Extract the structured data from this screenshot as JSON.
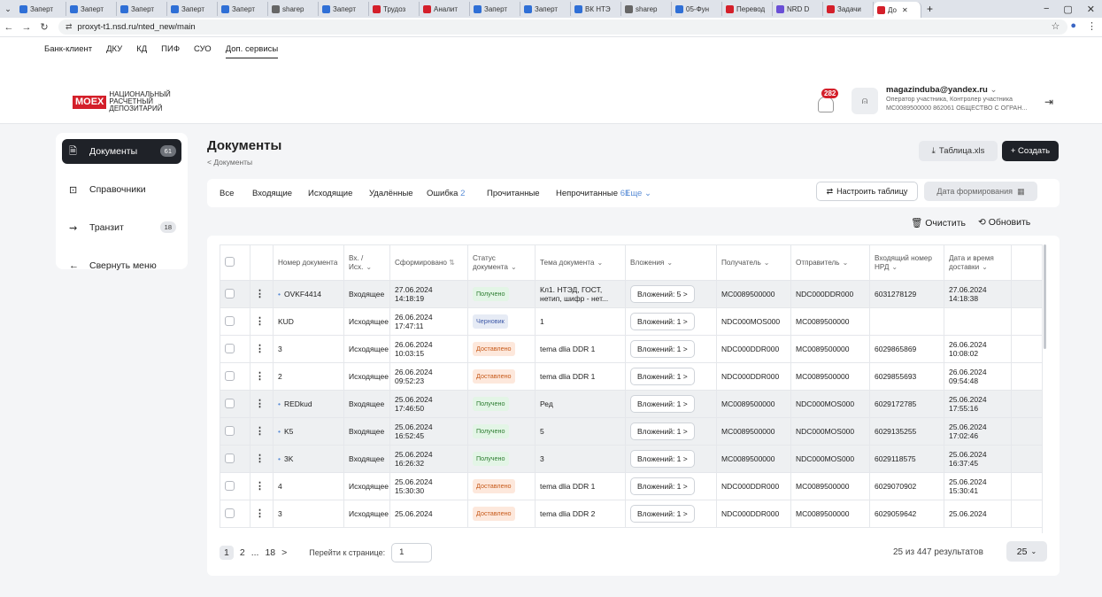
{
  "browser": {
    "tabs": [
      {
        "label": "Заперт",
        "color": "#2f6fd6"
      },
      {
        "label": "Заперт",
        "color": "#2f6fd6"
      },
      {
        "label": "Заперт",
        "color": "#2f6fd6"
      },
      {
        "label": "Заперт",
        "color": "#2f6fd6"
      },
      {
        "label": "Заперт",
        "color": "#2f6fd6"
      },
      {
        "label": "sharep",
        "color": "#666666"
      },
      {
        "label": "Заперт",
        "color": "#2f6fd6"
      },
      {
        "label": "Трудоз",
        "color": "#d41f2a"
      },
      {
        "label": "Аналит",
        "color": "#d41f2a"
      },
      {
        "label": "Заперт",
        "color": "#2f6fd6"
      },
      {
        "label": "Заперт",
        "color": "#2f6fd6"
      },
      {
        "label": "ВК НТЭ",
        "color": "#2f6fd6"
      },
      {
        "label": "sharep",
        "color": "#666666"
      },
      {
        "label": "05-Фун",
        "color": "#2f6fd6"
      },
      {
        "label": "Перевод",
        "color": "#d41f2a"
      },
      {
        "label": "NRD D",
        "color": "#6a4fd6"
      },
      {
        "label": "Задачи",
        "color": "#d41f2a"
      },
      {
        "label": "До",
        "color": "#d41f2a",
        "active": true
      }
    ],
    "new_tab": "+",
    "url": "proxyt-t1.nsd.ru/nted_new/main",
    "win_min": "−",
    "win_max": "▢",
    "win_close": "✕"
  },
  "site_menu": [
    "Банк-клиент",
    "ДКУ",
    "КД",
    "ПИФ",
    "СУО",
    "Доп. сервисы"
  ],
  "logo": {
    "moex": "MOEX",
    "line1": "НАЦИОНАЛЬНЫЙ",
    "line2": "РАСЧЕТНЫЙ",
    "line3": "ДЕПОЗИТАРИЙ"
  },
  "header": {
    "notifications": "282",
    "email": "magazinduba@yandex.ru",
    "role": "Оператор участника, Контролер участника",
    "org": "MC0089500000 862061 ОБЩЕСТВО С ОГРАН..."
  },
  "sidebar": {
    "items": [
      {
        "label": "Документы",
        "count": "61",
        "icon": "document-icon"
      },
      {
        "label": "Справочники",
        "count": "",
        "icon": "directory-icon"
      },
      {
        "label": "Транзит",
        "count": "18",
        "icon": "transit-icon"
      },
      {
        "label": "Свернуть меню",
        "count": "",
        "icon": "arrow-left-icon"
      }
    ]
  },
  "page": {
    "title": "Документы",
    "breadcrumb": "< Документы",
    "xls_button": "Таблица.xls",
    "create_button": "+ Создать"
  },
  "filters": {
    "tabs": [
      {
        "label": "Все",
        "count": ""
      },
      {
        "label": "Входящие",
        "count": ""
      },
      {
        "label": "Исходящие",
        "count": ""
      },
      {
        "label": "Удалённые",
        "count": ""
      },
      {
        "label": "Ошибка",
        "count": "2"
      },
      {
        "label": "Прочитанные",
        "count": ""
      },
      {
        "label": "Непрочитанные",
        "count": "61"
      }
    ],
    "more": "Еще",
    "configure": "Настроить таблицу",
    "date": "Дата формирования"
  },
  "actions": {
    "clear": "Очистить",
    "refresh": "Обновить"
  },
  "table": {
    "headers": [
      "Номер документа",
      "Вх. / Исх.",
      "Сформировано",
      "Статус документа",
      "Тема документа",
      "Вложения",
      "Получатель",
      "Отправитель",
      "Входящий номер НРД",
      "Дата и время доставки"
    ],
    "rows": [
      {
        "num": "OVKF4414",
        "unread": true,
        "dir": "Входящее",
        "date": "27.06.2024",
        "time": "14:18:19",
        "status": "Получено",
        "topic": "Кл1. НТЭД, ГОСТ, нетип, шифр - нет...",
        "att": "Вложений: 5 >",
        "rcpt": "MC0089500000",
        "sender": "NDC000DDR000",
        "nrd": "6031278129",
        "ddate": "27.06.2024",
        "dtime": "14:18:38"
      },
      {
        "num": "KUD",
        "unread": false,
        "dir": "Исходящее",
        "date": "26.06.2024",
        "time": "17:47:11",
        "status": "Черновик",
        "topic": "1",
        "att": "Вложений: 1 >",
        "rcpt": "NDC000MOS000",
        "sender": "MC0089500000",
        "nrd": "",
        "ddate": "",
        "dtime": ""
      },
      {
        "num": "3",
        "unread": false,
        "dir": "Исходящее",
        "date": "26.06.2024",
        "time": "10:03:15",
        "status": "Доставлено",
        "topic": "tema dlia DDR 1",
        "att": "Вложений: 1 >",
        "rcpt": "NDC000DDR000",
        "sender": "MC0089500000",
        "nrd": "6029865869",
        "ddate": "26.06.2024",
        "dtime": "10:08:02"
      },
      {
        "num": "2",
        "unread": false,
        "dir": "Исходящее",
        "date": "26.06.2024",
        "time": "09:52:23",
        "status": "Доставлено",
        "topic": "tema dlia DDR 1",
        "att": "Вложений: 1 >",
        "rcpt": "NDC000DDR000",
        "sender": "MC0089500000",
        "nrd": "6029855693",
        "ddate": "26.06.2024",
        "dtime": "09:54:48"
      },
      {
        "num": "REDkud",
        "unread": true,
        "dir": "Входящее",
        "date": "25.06.2024",
        "time": "17:46:50",
        "status": "Получено",
        "topic": "Ред",
        "att": "Вложений: 1 >",
        "rcpt": "MC0089500000",
        "sender": "NDC000MOS000",
        "nrd": "6029172785",
        "ddate": "25.06.2024",
        "dtime": "17:55:16"
      },
      {
        "num": "K5",
        "unread": true,
        "dir": "Входящее",
        "date": "25.06.2024",
        "time": "16:52:45",
        "status": "Получено",
        "topic": "5",
        "att": "Вложений: 1 >",
        "rcpt": "MC0089500000",
        "sender": "NDC000MOS000",
        "nrd": "6029135255",
        "ddate": "25.06.2024",
        "dtime": "17:02:46"
      },
      {
        "num": "3K",
        "unread": true,
        "dir": "Входящее",
        "date": "25.06.2024",
        "time": "16:26:32",
        "status": "Получено",
        "topic": "3",
        "att": "Вложений: 1 >",
        "rcpt": "MC0089500000",
        "sender": "NDC000MOS000",
        "nrd": "6029118575",
        "ddate": "25.06.2024",
        "dtime": "16:37:45"
      },
      {
        "num": "4",
        "unread": false,
        "dir": "Исходящее",
        "date": "25.06.2024",
        "time": "15:30:30",
        "status": "Доставлено",
        "topic": "tema dlia DDR 1",
        "att": "Вложений: 1 >",
        "rcpt": "NDC000DDR000",
        "sender": "MC0089500000",
        "nrd": "6029070902",
        "ddate": "25.06.2024",
        "dtime": "15:30:41"
      },
      {
        "num": "3",
        "unread": false,
        "dir": "Исходящее",
        "date": "25.06.2024",
        "time": "",
        "status": "Доставлено",
        "topic": "tema dlia DDR 2",
        "att": "Вложений: 1 >",
        "rcpt": "NDC000DDR000",
        "sender": "MC0089500000",
        "nrd": "6029059642",
        "ddate": "25.06.2024",
        "dtime": ""
      }
    ],
    "status_colors": {
      "Получено": {
        "bg": "#e3f5e6",
        "fg": "#2e7d32"
      },
      "Черновик": {
        "bg": "#e6ebf5",
        "fg": "#3f5aa8"
      },
      "Доставлено": {
        "bg": "#fde8dc",
        "fg": "#c75a1a"
      }
    }
  },
  "pagination": {
    "pages": [
      "1",
      "2",
      "...",
      "18",
      ">"
    ],
    "goto_label": "Перейти к странице:",
    "goto_value": "1",
    "results": "25 из 447 результатов",
    "page_size": "25"
  }
}
